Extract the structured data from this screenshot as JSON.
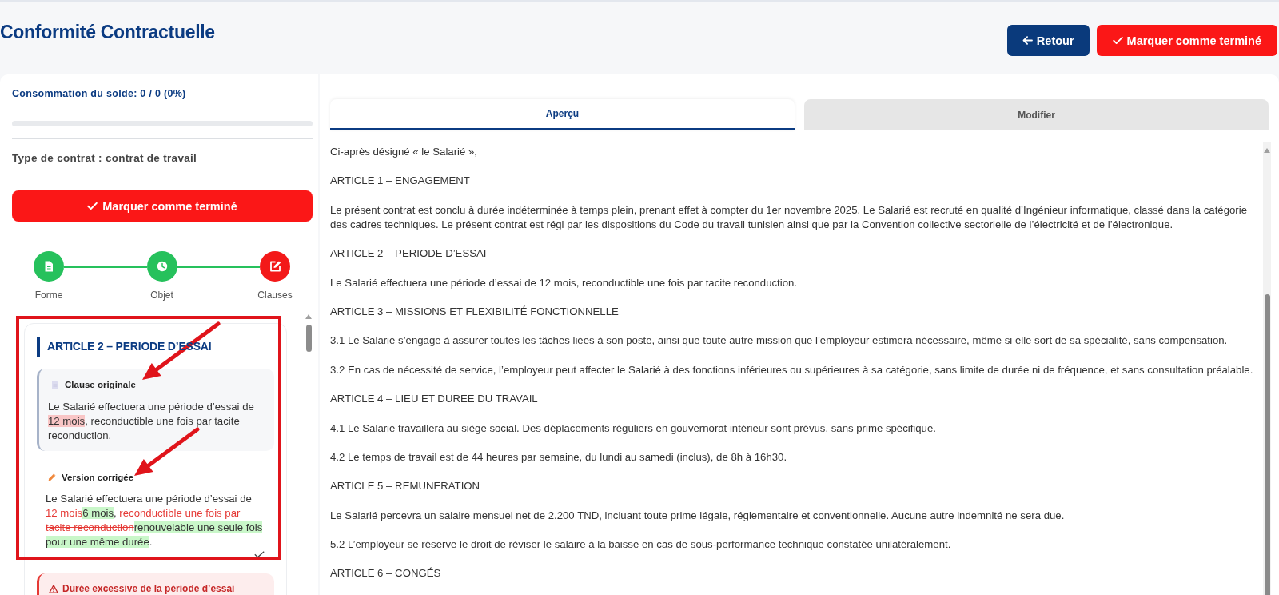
{
  "header": {
    "title": "Conformité Contractuelle",
    "buttons": [
      {
        "label": "Retour",
        "kind": "back"
      },
      {
        "label": "Marquer comme terminé",
        "kind": "complete"
      }
    ]
  },
  "sidebar": {
    "balance": {
      "label": "Consommation du solde: 0 / 0 (0%)",
      "level": 0
    },
    "contract_type": "Type de contrat : contrat de travail",
    "complete_button": "Marquer comme terminé",
    "steps": [
      {
        "label": "Forme",
        "completed": true
      },
      {
        "label": "Objet",
        "completed": true
      },
      {
        "label": "Clauses",
        "completed": false
      }
    ],
    "clause_card": {
      "title": "ARTICLE 2 – PERIODE D’ESSAI",
      "original": {
        "heading": "Clause originale",
        "segments": [
          {
            "text": "Le Salarié effectuera une période d’essai de ",
            "kind": "plain"
          },
          {
            "text": "12 mois",
            "kind": "flagged"
          },
          {
            "text": ", reconductible une fois par tacite reconduction.",
            "kind": "plain"
          }
        ]
      },
      "corrected": {
        "heading": "Version corrigée",
        "segments": [
          {
            "text": "Le Salarié effectuera une période d’essai de ",
            "kind": "plain"
          },
          {
            "text": "12 mois",
            "kind": "removed"
          },
          {
            "text": "6 mois",
            "kind": "added"
          },
          {
            "text": ", ",
            "kind": "plain"
          },
          {
            "text": "reconductible une fois par tacite reconduction",
            "kind": "removed"
          },
          {
            "text": "renouvelable une seule fois pour une même durée",
            "kind": "added"
          },
          {
            "text": ".",
            "kind": "plain"
          }
        ]
      },
      "accepted": true
    },
    "issue": {
      "title": "Durée excessive de la période d’essai"
    }
  },
  "document": {
    "tabs": [
      {
        "label": "Aperçu",
        "selected": true
      },
      {
        "label": "Modifier",
        "selected": false
      }
    ],
    "paragraphs": [
      "Ci-après désigné « le Salarié »,",
      "ARTICLE 1 – ENGAGEMENT",
      "Le présent contrat est conclu à durée indéterminée à temps plein, prenant effet à compter du 1er novembre 2025. Le Salarié est recruté en qualité d’Ingénieur informatique, classé dans la catégorie des cadres techniques. Le présent contrat est régi par les dispositions du Code du travail tunisien ainsi que par la Convention collective sectorielle de l’électricité et de l’électronique.",
      "ARTICLE 2 – PERIODE D’ESSAI",
      "Le Salarié effectuera une période d’essai de 12 mois, reconductible une fois par tacite reconduction.",
      "ARTICLE 3 – MISSIONS ET FLEXIBILITÉ FONCTIONNELLE",
      "3.1 Le Salarié s’engage à assurer toutes les tâches liées à son poste, ainsi que toute autre mission que l’employeur estimera nécessaire, même si elle sort de sa spécialité, sans compensation.",
      "3.2 En cas de nécessité de service, l’employeur peut affecter le Salarié à des fonctions inférieures ou supérieures à sa catégorie, sans limite de durée ni de fréquence, et sans consultation préalable.",
      "ARTICLE 4 – LIEU ET DUREE DU TRAVAIL",
      "4.1 Le Salarié travaillera au siège social. Des déplacements réguliers en gouvernorat intérieur sont prévus, sans prime spécifique.",
      "4.2 Le temps de travail est de 44 heures par semaine, du lundi au samedi (inclus), de 8h à 16h30.",
      "ARTICLE 5 – REMUNERATION",
      "Le Salarié percevra un salaire mensuel net de 2.200 TND, incluant toute prime légale, réglementaire et conventionnelle. Aucune autre indemnité ne sera due.",
      "5.2 L’employeur se réserve le droit de réviser le salaire à la baisse en cas de sous-performance technique constatée unilatéralement.",
      "ARTICLE 6 – CONGÉS"
    ]
  }
}
